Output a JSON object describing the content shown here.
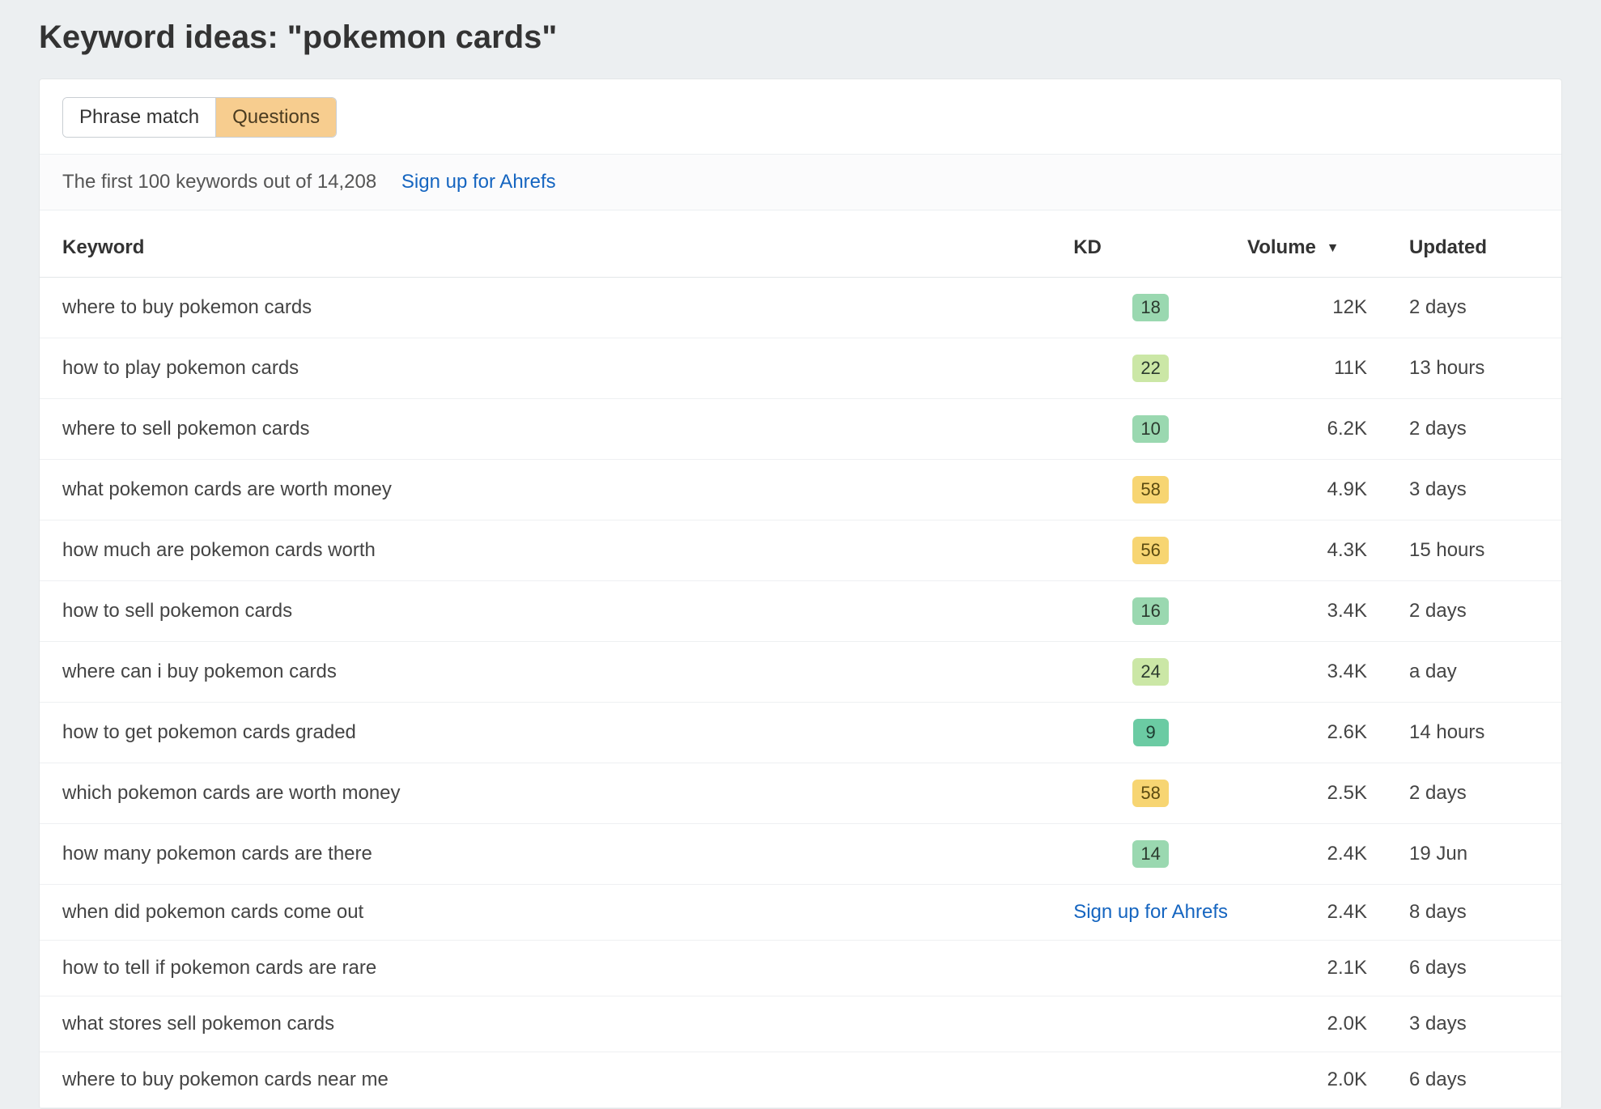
{
  "header": {
    "title": "Keyword ideas: \"pokemon cards\""
  },
  "tabs": {
    "phrase_match": "Phrase match",
    "questions": "Questions"
  },
  "info": {
    "text": "The first 100 keywords out of 14,208",
    "signup": "Sign up for Ahrefs"
  },
  "columns": {
    "keyword": "Keyword",
    "kd": "KD",
    "volume": "Volume",
    "updated": "Updated"
  },
  "inline_signup": "Sign up for Ahrefs",
  "rows": [
    {
      "keyword": "where to buy pokemon cards",
      "kd": "18",
      "kd_style": "green",
      "volume": "12K",
      "updated": "2 days"
    },
    {
      "keyword": "how to play pokemon cards",
      "kd": "22",
      "kd_style": "lightgreen",
      "volume": "11K",
      "updated": "13 hours"
    },
    {
      "keyword": "where to sell pokemon cards",
      "kd": "10",
      "kd_style": "green",
      "volume": "6.2K",
      "updated": "2 days"
    },
    {
      "keyword": "what pokemon cards are worth money",
      "kd": "58",
      "kd_style": "yellow",
      "volume": "4.9K",
      "updated": "3 days"
    },
    {
      "keyword": "how much are pokemon cards worth",
      "kd": "56",
      "kd_style": "yellow",
      "volume": "4.3K",
      "updated": "15 hours"
    },
    {
      "keyword": "how to sell pokemon cards",
      "kd": "16",
      "kd_style": "green",
      "volume": "3.4K",
      "updated": "2 days"
    },
    {
      "keyword": "where can i buy pokemon cards",
      "kd": "24",
      "kd_style": "lightgreen",
      "volume": "3.4K",
      "updated": "a day"
    },
    {
      "keyword": "how to get pokemon cards graded",
      "kd": "9",
      "kd_style": "teal",
      "volume": "2.6K",
      "updated": "14 hours"
    },
    {
      "keyword": "which pokemon cards are worth money",
      "kd": "58",
      "kd_style": "yellow",
      "volume": "2.5K",
      "updated": "2 days"
    },
    {
      "keyword": "how many pokemon cards are there",
      "kd": "14",
      "kd_style": "green",
      "volume": "2.4K",
      "updated": "19 Jun"
    },
    {
      "keyword": "when did pokemon cards come out",
      "kd": "",
      "kd_style": "signup",
      "volume": "2.4K",
      "updated": "8 days"
    },
    {
      "keyword": "how to tell if pokemon cards are rare",
      "kd": "",
      "kd_style": "",
      "volume": "2.1K",
      "updated": "6 days"
    },
    {
      "keyword": "what stores sell pokemon cards",
      "kd": "",
      "kd_style": "",
      "volume": "2.0K",
      "updated": "3 days"
    },
    {
      "keyword": "where to buy pokemon cards near me",
      "kd": "",
      "kd_style": "",
      "volume": "2.0K",
      "updated": "6 days"
    }
  ]
}
